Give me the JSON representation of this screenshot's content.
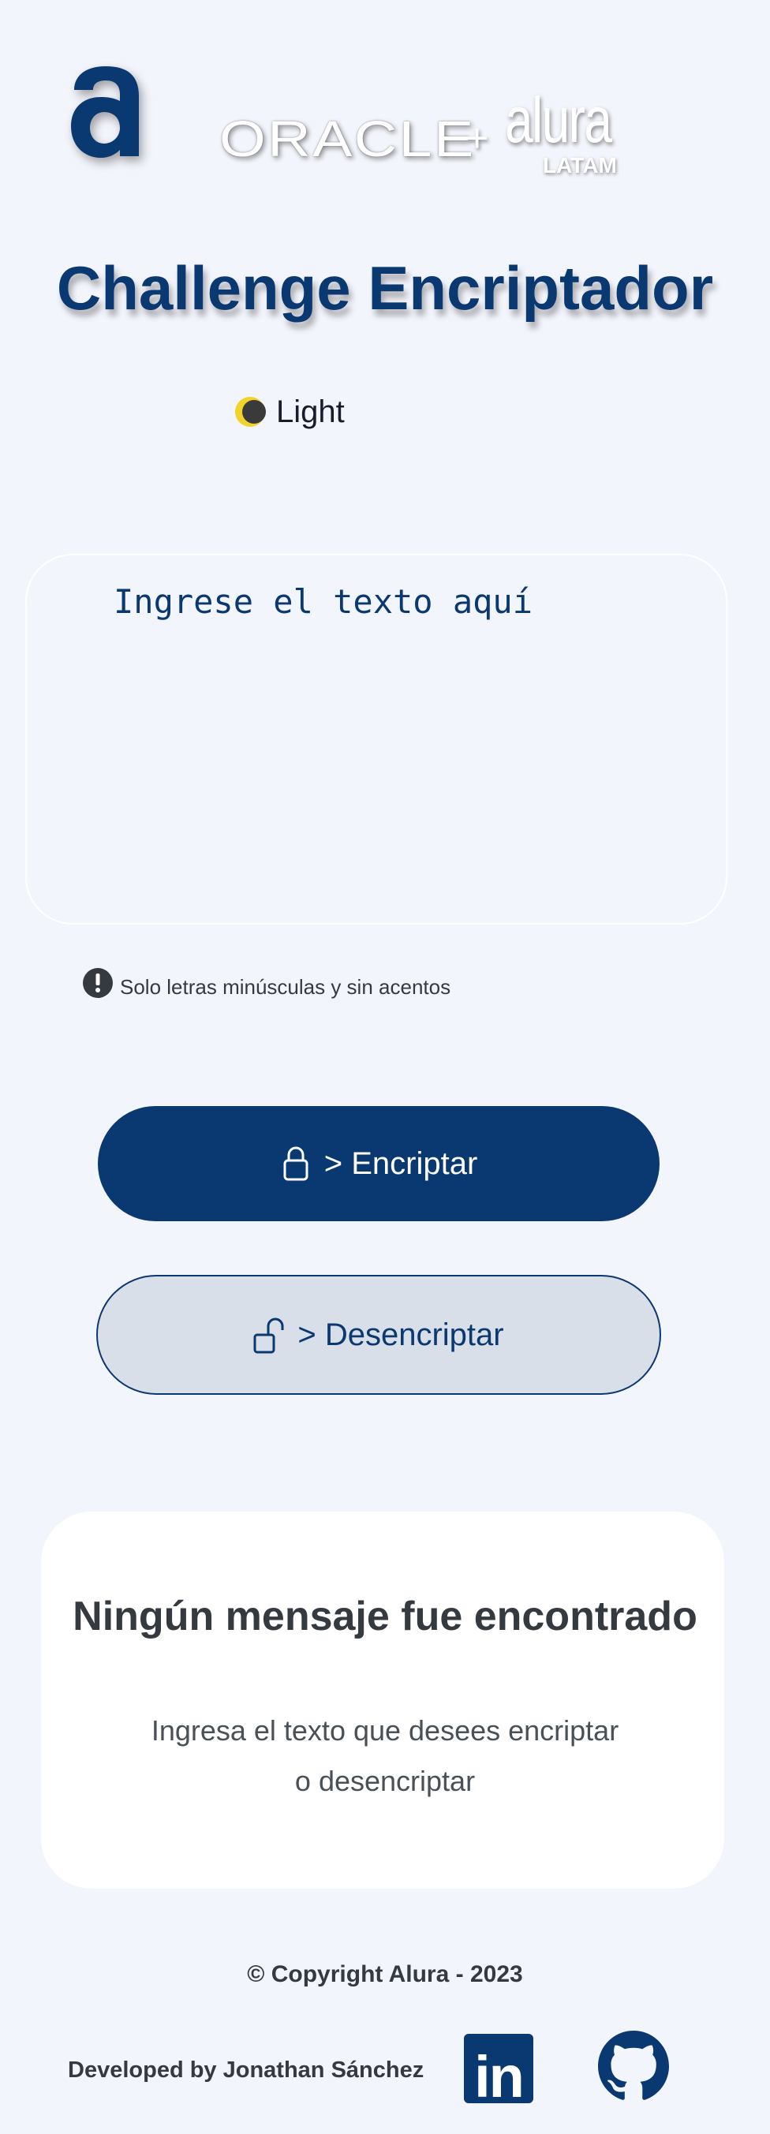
{
  "header": {
    "logo_letter": "a",
    "partner_logo": {
      "oracle": "ORACLE",
      "plus": "+",
      "alura": "alura",
      "latam": "LATAM"
    },
    "title": "Challenge Encriptador"
  },
  "theme_toggle": {
    "label": "Light",
    "icon": "moon-icon"
  },
  "input": {
    "placeholder": "Ingrese el texto aquí",
    "value": ""
  },
  "hint": {
    "icon": "exclamation-circle-icon",
    "text": "Solo letras minúsculas y sin acentos"
  },
  "buttons": {
    "encrypt": {
      "label": "> Encriptar",
      "icon": "lock-icon"
    },
    "decrypt": {
      "label": "> Desencriptar",
      "icon": "unlock-icon"
    }
  },
  "output": {
    "title": "Ningún mensaje fue encontrado",
    "subtitle_line1": "Ingresa el texto que desees encriptar",
    "subtitle_line2": "o desencriptar"
  },
  "footer": {
    "copyright": "© Copyright Alura - 2023",
    "developer": "Developed by Jonathan Sánchez",
    "linkedin_icon": "linkedin-icon",
    "linkedin_text": "in",
    "github_icon": "github-icon"
  },
  "colors": {
    "background": "#f3f5fc",
    "primary": "#0a3871",
    "secondary_button": "#d8dfe8",
    "card": "#ffffff",
    "text_dark": "#343a40"
  }
}
